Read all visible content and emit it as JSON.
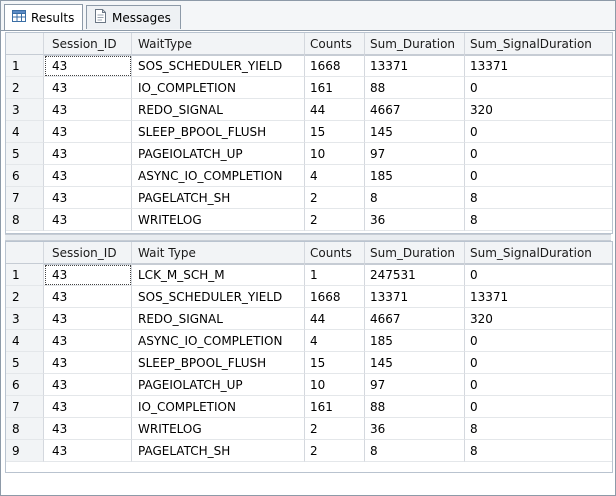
{
  "tabs": [
    {
      "label": "Results",
      "icon": "grid-icon",
      "active": true
    },
    {
      "label": "Messages",
      "icon": "messages-icon",
      "active": false
    }
  ],
  "grids": [
    {
      "columns": [
        "",
        "Session_ID",
        "WaitType",
        "Counts",
        "Sum_Duration",
        "Sum_SignalDuration"
      ],
      "rows": [
        [
          "1",
          "43",
          "SOS_SCHEDULER_YIELD",
          "1668",
          "13371",
          "13371"
        ],
        [
          "2",
          "43",
          "IO_COMPLETION",
          "161",
          "88",
          "0"
        ],
        [
          "3",
          "43",
          "REDO_SIGNAL",
          "44",
          "4667",
          "320"
        ],
        [
          "4",
          "43",
          "SLEEP_BPOOL_FLUSH",
          "15",
          "145",
          "0"
        ],
        [
          "5",
          "43",
          "PAGEIOLATCH_UP",
          "10",
          "97",
          "0"
        ],
        [
          "6",
          "43",
          "ASYNC_IO_COMPLETION",
          "4",
          "185",
          "0"
        ],
        [
          "7",
          "43",
          "PAGELATCH_SH",
          "2",
          "8",
          "8"
        ],
        [
          "8",
          "43",
          "WRITELOG",
          "2",
          "36",
          "8"
        ]
      ]
    },
    {
      "columns": [
        "",
        "Session_ID",
        "Wait Type",
        "Counts",
        "Sum_Duration",
        "Sum_SignalDuration"
      ],
      "rows": [
        [
          "1",
          "43",
          "LCK_M_SCH_M",
          "1",
          "247531",
          "0"
        ],
        [
          "2",
          "43",
          "SOS_SCHEDULER_YIELD",
          "1668",
          "13371",
          "13371"
        ],
        [
          "3",
          "43",
          "REDO_SIGNAL",
          "44",
          "4667",
          "320"
        ],
        [
          "4",
          "43",
          "ASYNC_IO_COMPLETION",
          "4",
          "185",
          "0"
        ],
        [
          "5",
          "43",
          "SLEEP_BPOOL_FLUSH",
          "15",
          "145",
          "0"
        ],
        [
          "6",
          "43",
          "PAGEIOLATCH_UP",
          "10",
          "97",
          "0"
        ],
        [
          "7",
          "43",
          "IO_COMPLETION",
          "161",
          "88",
          "0"
        ],
        [
          "8",
          "43",
          "WRITELOG",
          "2",
          "36",
          "8"
        ],
        [
          "9",
          "43",
          "PAGELATCH_SH",
          "2",
          "8",
          "8"
        ]
      ]
    }
  ],
  "colors": {
    "border": "#8d9aa8",
    "header_bg": "#f2f4f6",
    "tab_bg": "#eef1f4"
  }
}
